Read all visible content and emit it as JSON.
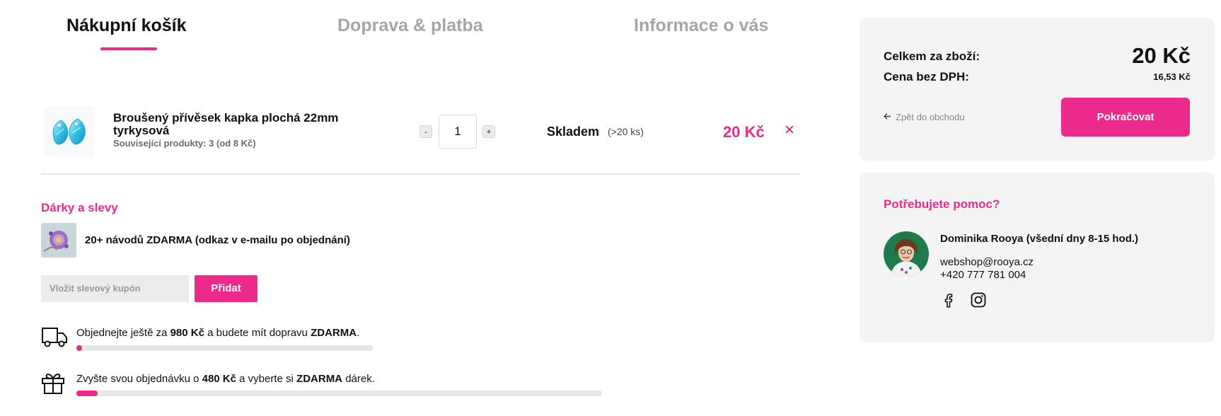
{
  "steps": [
    {
      "label": "Nákupní košík"
    },
    {
      "label": "Doprava & platba"
    },
    {
      "label": "Informace o vás"
    }
  ],
  "cart": {
    "item": {
      "name": "Broušený přívěsek kapka plochá 22mm tyrkysová",
      "related_prefix": "Související produkty: ",
      "related_count": "3",
      "related_suffix": " (od 8 Kč)",
      "quantity": "1",
      "qty_minus": "-",
      "qty_plus": "+",
      "stock": "Skladem",
      "stock_count": "(>20 ks)",
      "price": "20 Kč",
      "remove": "×"
    }
  },
  "gifts": {
    "title": "Dárky a slevy",
    "gift_text": "20+ návodů ZDARMA (odkaz v e-mailu po objednání)",
    "coupon_placeholder": "Vložit slevový kupón",
    "coupon_button": "Přidat"
  },
  "progress": {
    "shipping": {
      "pre": "Objednejte ještě za ",
      "amount": "980 Kč",
      "mid": " a budete mít dopravu ",
      "free": "ZDARMA",
      "post": ".",
      "fraction": 0.02
    },
    "gift": {
      "pre": "Zvyšte svou objednávku o ",
      "amount": "480 Kč",
      "mid": " a vyberte si ",
      "free": "ZDARMA",
      "post": " dárek.",
      "fraction": 0.04
    }
  },
  "summary": {
    "total_label": "Celkem za zboží:",
    "total_value": "20 Kč",
    "net_label": "Cena bez DPH:",
    "net_value": "16,53 Kč",
    "back_label": "Zpět do obchodu",
    "continue_label": "Pokračovat"
  },
  "help": {
    "title": "Potřebujete pomoc?",
    "name": "Dominika Rooya (všední dny 8-15 hod.)",
    "email": "webshop@rooya.cz",
    "phone": "+420 777 781 004"
  },
  "colors": {
    "accent": "#ec2a8b",
    "remove": "#d8203b",
    "card_bg": "#f4f4f4"
  },
  "icons": [
    "truck-icon",
    "gift-icon",
    "arrow-left-icon",
    "facebook-icon",
    "instagram-icon",
    "close-icon"
  ]
}
